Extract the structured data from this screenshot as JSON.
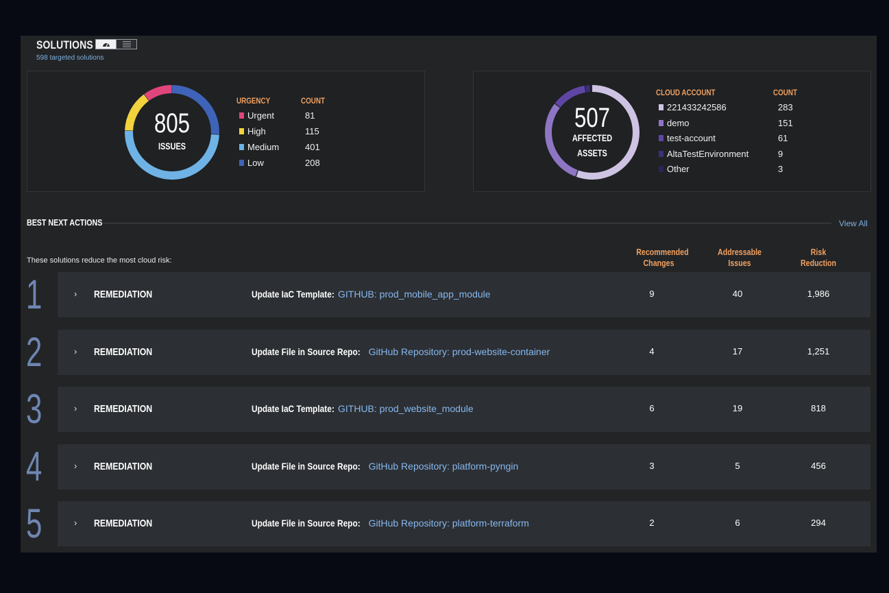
{
  "header": {
    "title": "SOLUTIONS",
    "subtitle": "598 targeted solutions",
    "view_toggle": [
      "gauge-icon",
      "list-icon"
    ]
  },
  "issues_card": {
    "total": "805",
    "label": "ISSUES",
    "legend_header": "URGENCY",
    "count_header": "COUNT",
    "items": [
      {
        "label": "Urgent",
        "count": "81",
        "color": "#e0457b"
      },
      {
        "label": "High",
        "count": "115",
        "color": "#f3d33d"
      },
      {
        "label": "Medium",
        "count": "401",
        "color": "#6fb3e6"
      },
      {
        "label": "Low",
        "count": "208",
        "color": "#3f63b8"
      }
    ]
  },
  "assets_card": {
    "total": "507",
    "label_line1": "AFFECTED",
    "label_line2": "ASSETS",
    "legend_header": "CLOUD ACCOUNT",
    "count_header": "COUNT",
    "items": [
      {
        "label": "221433242586",
        "count": "283",
        "color": "#cfc3e3"
      },
      {
        "label": "demo",
        "count": "151",
        "color": "#8e76c4"
      },
      {
        "label": "test-account",
        "count": "61",
        "color": "#5f46a6"
      },
      {
        "label": "AltaTestEnvironment",
        "count": "9",
        "color": "#3d2f7a"
      },
      {
        "label": "Other",
        "count": "3",
        "color": "#2b2458"
      }
    ]
  },
  "best_next_actions": {
    "title": "BEST NEXT ACTIONS",
    "view_all": "View All",
    "subtitle": "These solutions reduce the most cloud risk:",
    "columns": {
      "changes": [
        "Recommended",
        "Changes"
      ],
      "issues": [
        "Addressable",
        "Issues"
      ],
      "risk": [
        "Risk",
        "Reduction"
      ]
    },
    "rows": [
      {
        "rank": "1",
        "type": "REMEDIATION",
        "action": "Update IaC Template:",
        "target": "GITHUB: prod_mobile_app_module",
        "changes": "9",
        "issues": "40",
        "risk": "1,986"
      },
      {
        "rank": "2",
        "type": "REMEDIATION",
        "action": "Update File in Source Repo:",
        "target": "GitHub Repository: prod-website-container",
        "changes": "4",
        "issues": "17",
        "risk": "1,251"
      },
      {
        "rank": "3",
        "type": "REMEDIATION",
        "action": "Update IaC Template:",
        "target": "GITHUB: prod_website_module",
        "changes": "6",
        "issues": "19",
        "risk": "818"
      },
      {
        "rank": "4",
        "type": "REMEDIATION",
        "action": "Update File in Source Repo:",
        "target": "GitHub Repository: platform-pyngin",
        "changes": "3",
        "issues": "5",
        "risk": "456"
      },
      {
        "rank": "5",
        "type": "REMEDIATION",
        "action": "Update File in Source Repo:",
        "target": "GitHub Repository: platform-terraform",
        "changes": "2",
        "issues": "6",
        "risk": "294"
      }
    ]
  }
}
